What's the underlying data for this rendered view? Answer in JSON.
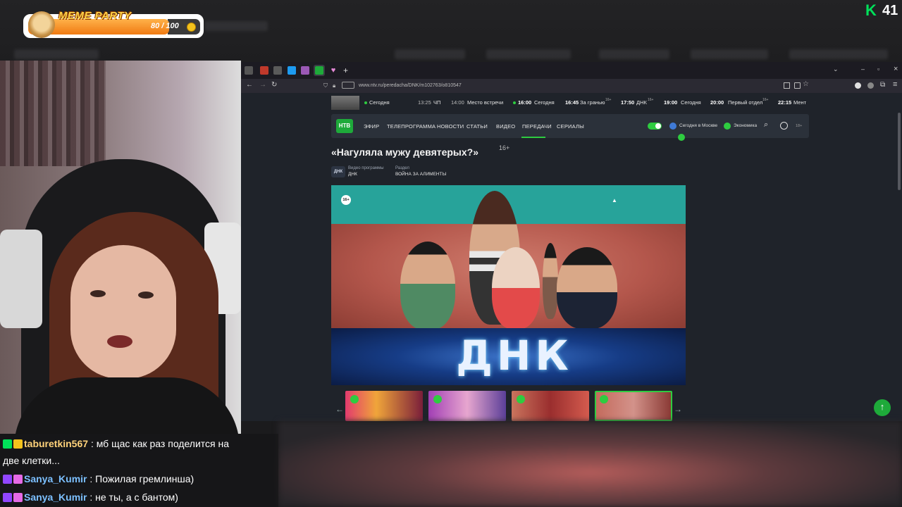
{
  "overlay": {
    "meme_party_title": "MEME PARTY",
    "meme_progress": "80 / 100",
    "meme_progress_value": 0.8,
    "viewer_count": "41",
    "k_logo": "K"
  },
  "browser": {
    "url": "www.ntv.ru/peredacha/DNK/m102763/o810547",
    "new_tab": "+",
    "window_min": "–",
    "window_max": "▫",
    "window_close": "×"
  },
  "schedule": [
    {
      "time": "",
      "title": "Сегодня",
      "live": true
    },
    {
      "time": "13:25",
      "title": "ЧП",
      "live": false
    },
    {
      "time": "14:00",
      "title": "Место встречи",
      "live": false
    },
    {
      "time": "16:00",
      "title": "Сегодня",
      "live": true
    },
    {
      "time": "16:45",
      "title": "За гранью",
      "age": "16+",
      "live": false
    },
    {
      "time": "17:50",
      "title": "ДНК",
      "age": "16+",
      "live": false
    },
    {
      "time": "19:00",
      "title": "Сегодня",
      "live": false
    },
    {
      "time": "20:00",
      "title": "Первый отдел",
      "age": "16+",
      "live": false
    },
    {
      "time": "22:15",
      "title": "Мент",
      "live": false
    }
  ],
  "menu": {
    "logo": "НТВ",
    "items": [
      "ЭФИР",
      "ТЕЛЕПРОГРАММА",
      "НОВОСТИ",
      "СТАТЬИ",
      "ВИДЕО",
      "ПЕРЕДАЧИ",
      "СЕРИАЛЫ"
    ],
    "active": "ПЕРЕДАЧИ",
    "channel1": "Сегодня в Москве",
    "channel2": "Экономика",
    "age": "18+"
  },
  "article": {
    "title": "«Нагуляла мужу девятерых?»",
    "age": "16+",
    "program_label": "Видео программы",
    "program_value": "ДНК",
    "section_label": "Раздел",
    "section_value": "ВОЙНА ЗА АЛИМЕНТЫ",
    "logo": "ДНК",
    "video_age_badge": "16+",
    "video_banner": "ДНК"
  },
  "chat": [
    {
      "user": "taburetkin567",
      "message": ": мб щас как раз поделится на",
      "cont": "две клетки...",
      "badges": [
        "k-badge",
        "crown-badge"
      ]
    },
    {
      "user": "Sanya_Kumir",
      "message": ": Пожилая гремлинша)",
      "badges": [
        "twitch-badge",
        "heart-badge"
      ]
    },
    {
      "user": "Sanya_Kumir",
      "message": ": не ты, а с бантом)",
      "badges": [
        "twitch-badge",
        "heart-badge"
      ]
    }
  ],
  "colors": {
    "ntv_green": "#1eaa3a",
    "accent_green": "#2ecc40",
    "chat_username": "#7cc0ff",
    "chat_username_2": "#ffd27a"
  }
}
